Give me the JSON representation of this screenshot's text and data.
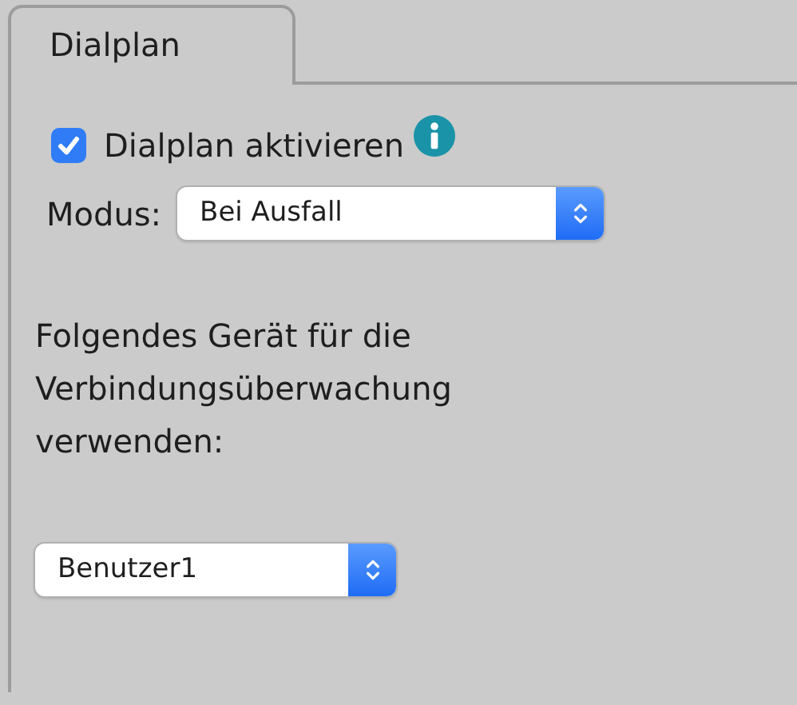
{
  "tabs": [
    {
      "label": "Dialplan",
      "selected": true
    }
  ],
  "enable": {
    "label": "Dialplan aktivieren",
    "checked": true
  },
  "mode": {
    "label": "Modus:",
    "value": "Bei Ausfall"
  },
  "description": "Folgendes Gerät für die Verbindungsüberwachung verwenden:",
  "device": {
    "value": "Benutzer1"
  }
}
